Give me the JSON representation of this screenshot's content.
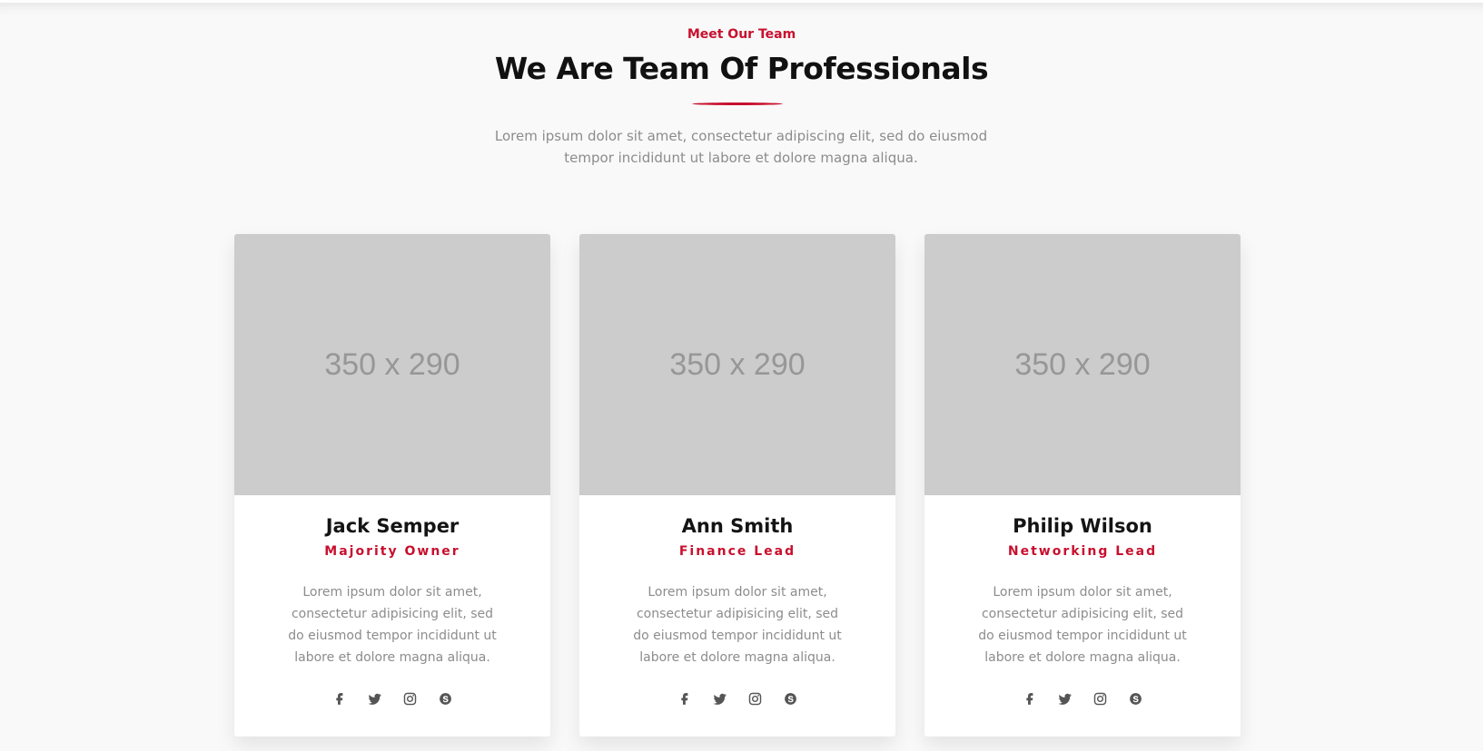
{
  "section": {
    "eyebrow": "Meet Our Team",
    "title": "We Are Team Of Professionals",
    "intro": "Lorem ipsum dolor sit amet, consectetur adipiscing elit, sed do eiusmod tempor incididunt ut labore et dolore magna aliqua."
  },
  "colors": {
    "accent": "#c8102e",
    "heading": "#141414",
    "body_text": "#8c8c8c",
    "placeholder_bg": "#cccccc",
    "placeholder_text": "#979797",
    "icon": "#555555"
  },
  "team": [
    {
      "photo_placeholder": "350 x 290",
      "name": "Jack Semper",
      "role": "Majority Owner",
      "bio": "Lorem ipsum dolor sit amet, consectetur adipisicing elit, sed do eiusmod tempor incididunt ut labore et dolore magna aliqua.",
      "socials": [
        "facebook-icon",
        "twitter-icon",
        "instagram-icon",
        "skype-icon"
      ]
    },
    {
      "photo_placeholder": "350 x 290",
      "name": "Ann Smith",
      "role": "Finance Lead",
      "bio": "Lorem ipsum dolor sit amet, consectetur adipisicing elit, sed do eiusmod tempor incididunt ut labore et dolore magna aliqua.",
      "socials": [
        "facebook-icon",
        "twitter-icon",
        "instagram-icon",
        "skype-icon"
      ]
    },
    {
      "photo_placeholder": "350 x 290",
      "name": "Philip Wilson",
      "role": "Networking Lead",
      "bio": "Lorem ipsum dolor sit amet, consectetur adipisicing elit, sed do eiusmod tempor incididunt ut labore et dolore magna aliqua.",
      "socials": [
        "facebook-icon",
        "twitter-icon",
        "instagram-icon",
        "skype-icon"
      ]
    }
  ]
}
